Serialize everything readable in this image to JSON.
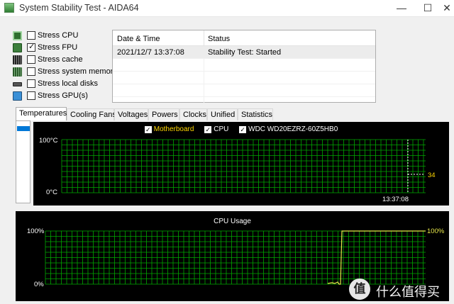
{
  "window": {
    "title": "System Stability Test - AIDA64",
    "minimize_glyph": "—",
    "maximize_glyph": "☐",
    "close_glyph": "✕"
  },
  "stress_options": [
    {
      "label": "Stress CPU",
      "checked": false,
      "icon": "cpu-icon"
    },
    {
      "label": "Stress FPU",
      "checked": true,
      "icon": "fpu-icon"
    },
    {
      "label": "Stress cache",
      "checked": false,
      "icon": "cache-icon"
    },
    {
      "label": "Stress system memory",
      "checked": false,
      "icon": "memory-icon"
    },
    {
      "label": "Stress local disks",
      "checked": false,
      "icon": "disk-icon"
    },
    {
      "label": "Stress GPU(s)",
      "checked": false,
      "icon": "monitor-icon"
    }
  ],
  "status_table": {
    "headers": [
      "Date & Time",
      "Status"
    ],
    "rows": [
      {
        "datetime": "2021/12/7 13:37:08",
        "status": "Stability Test: Started"
      }
    ]
  },
  "tabs": [
    {
      "label": "Temperatures",
      "active": true
    },
    {
      "label": "Cooling Fans",
      "active": false
    },
    {
      "label": "Voltages",
      "active": false
    },
    {
      "label": "Powers",
      "active": false
    },
    {
      "label": "Clocks",
      "active": false
    },
    {
      "label": "Unified",
      "active": false
    },
    {
      "label": "Statistics",
      "active": false
    }
  ],
  "temperature_graph": {
    "legend": [
      {
        "label": "Motherboard",
        "checked": true,
        "color": "#ffd700"
      },
      {
        "label": "CPU",
        "checked": true,
        "color": "#ffffff"
      },
      {
        "label": "WDC WD20EZRZ-60Z5HB0",
        "checked": true,
        "color": "#ffffff"
      }
    ],
    "y_max_label": "100°C",
    "y_min_label": "0°C",
    "time_label": "13:37:08",
    "current_value_label": "34",
    "grid_color": "#00a800",
    "value_color": "#ffd700"
  },
  "cpu_usage_graph": {
    "title": "CPU Usage",
    "y_max_label": "100%",
    "y_min_label": "0%",
    "current_value_label": "100%",
    "line_color": "#e8e84a",
    "grid_color": "#00a800"
  },
  "watermark": {
    "glyph": "值",
    "text": "什么值得买"
  }
}
